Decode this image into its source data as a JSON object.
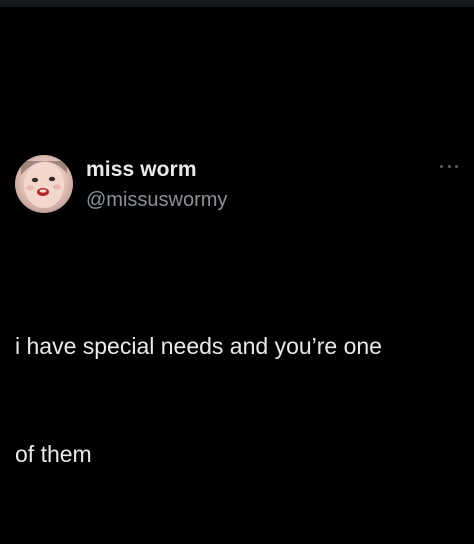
{
  "tweet": {
    "display_name": "miss worm",
    "handle": "@missuswormy",
    "text_line1": "i have special needs and you’re one",
    "text_line2": "of them",
    "avatar_icon": "profile-photo",
    "more_icon": "more-options-icon"
  },
  "colors": {
    "background": "#000000",
    "primary_text": "#e7e9ea",
    "secondary_text": "#8b9197",
    "top_strip": "#15181c"
  }
}
